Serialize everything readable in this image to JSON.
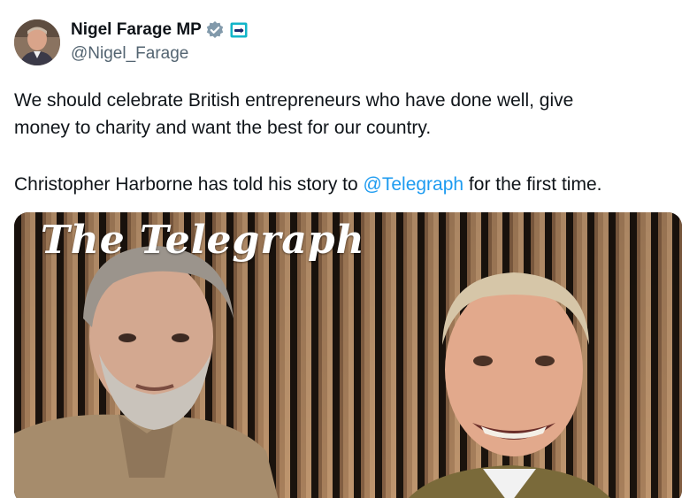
{
  "author": {
    "display_name": "Nigel Farage MP",
    "handle": "@Nigel_Farage",
    "verified_icon": "verified-badge-icon",
    "affiliation_icon": "affiliation-badge-icon"
  },
  "tweet": {
    "line1": "We should celebrate British entrepreneurs who have done well, give",
    "line2": "money to charity and want the best for our country.",
    "line3_prefix": "Christopher Harborne has told his story to ",
    "mention": "@Telegraph",
    "line3_suffix": " for the first time."
  },
  "media": {
    "masthead": "The Telegraph"
  },
  "colors": {
    "link": "#1d9bf0",
    "verified": "#829aab",
    "handle": "#536471"
  }
}
